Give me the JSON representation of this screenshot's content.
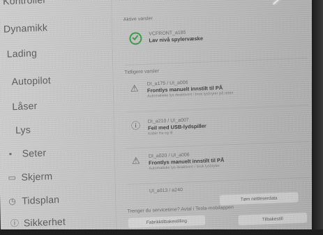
{
  "sidebar": {
    "items": [
      {
        "label": "Kontroller",
        "icon": "none"
      },
      {
        "label": "Dynamikk",
        "icon": "none"
      },
      {
        "label": "Lading",
        "icon": "none"
      },
      {
        "label": "Autopilot",
        "icon": "none"
      },
      {
        "label": "Låser",
        "icon": "none"
      },
      {
        "label": "Lys",
        "icon": "none"
      },
      {
        "label": "Seter",
        "icon": "seat-icon"
      },
      {
        "label": "Skjerm",
        "icon": "display-icon"
      },
      {
        "label": "Tidsplan",
        "icon": "clock-icon"
      },
      {
        "label": "Sikkerhet",
        "icon": "info-icon"
      }
    ]
  },
  "alerts": {
    "active_label": "Aktive varsler",
    "active": [
      {
        "code": "VCFRONT_a185",
        "title": "Lav nivå spylervæske",
        "sub": ""
      }
    ],
    "previous_label": "Tidligere varsler",
    "previous": [
      {
        "code": "DI_a175 / UI_a006",
        "title": "Frontlys manuelt innstilt til PÅ",
        "sub": "Automatiske lys deaktivert / bruk lysbryter på rattet"
      },
      {
        "code": "DI_a210 / UI_a007",
        "title": "Feil med USB-lydspiller",
        "sub": "Koble fra og til"
      },
      {
        "code": "DI_a020 / UI_a006",
        "title": "Frontlys manuelt innstilt til PÅ",
        "sub": "Automatiske lys deaktivert / bruk lysbryter"
      },
      {
        "code": "UI_a013 / a240",
        "title": "",
        "sub": ""
      }
    ]
  },
  "footer": {
    "question": "Trenger du servicetime? Avtal i Tesla-mobilappen",
    "btn_reset_factory": "Fabrikktilbakestilling",
    "btn_reset_settings": "Tøm nettleserdata",
    "btn_right": "Tilbakestill"
  },
  "colors": {
    "ok": "#2f9b3c",
    "text": "#333333",
    "muted": "#666666"
  }
}
